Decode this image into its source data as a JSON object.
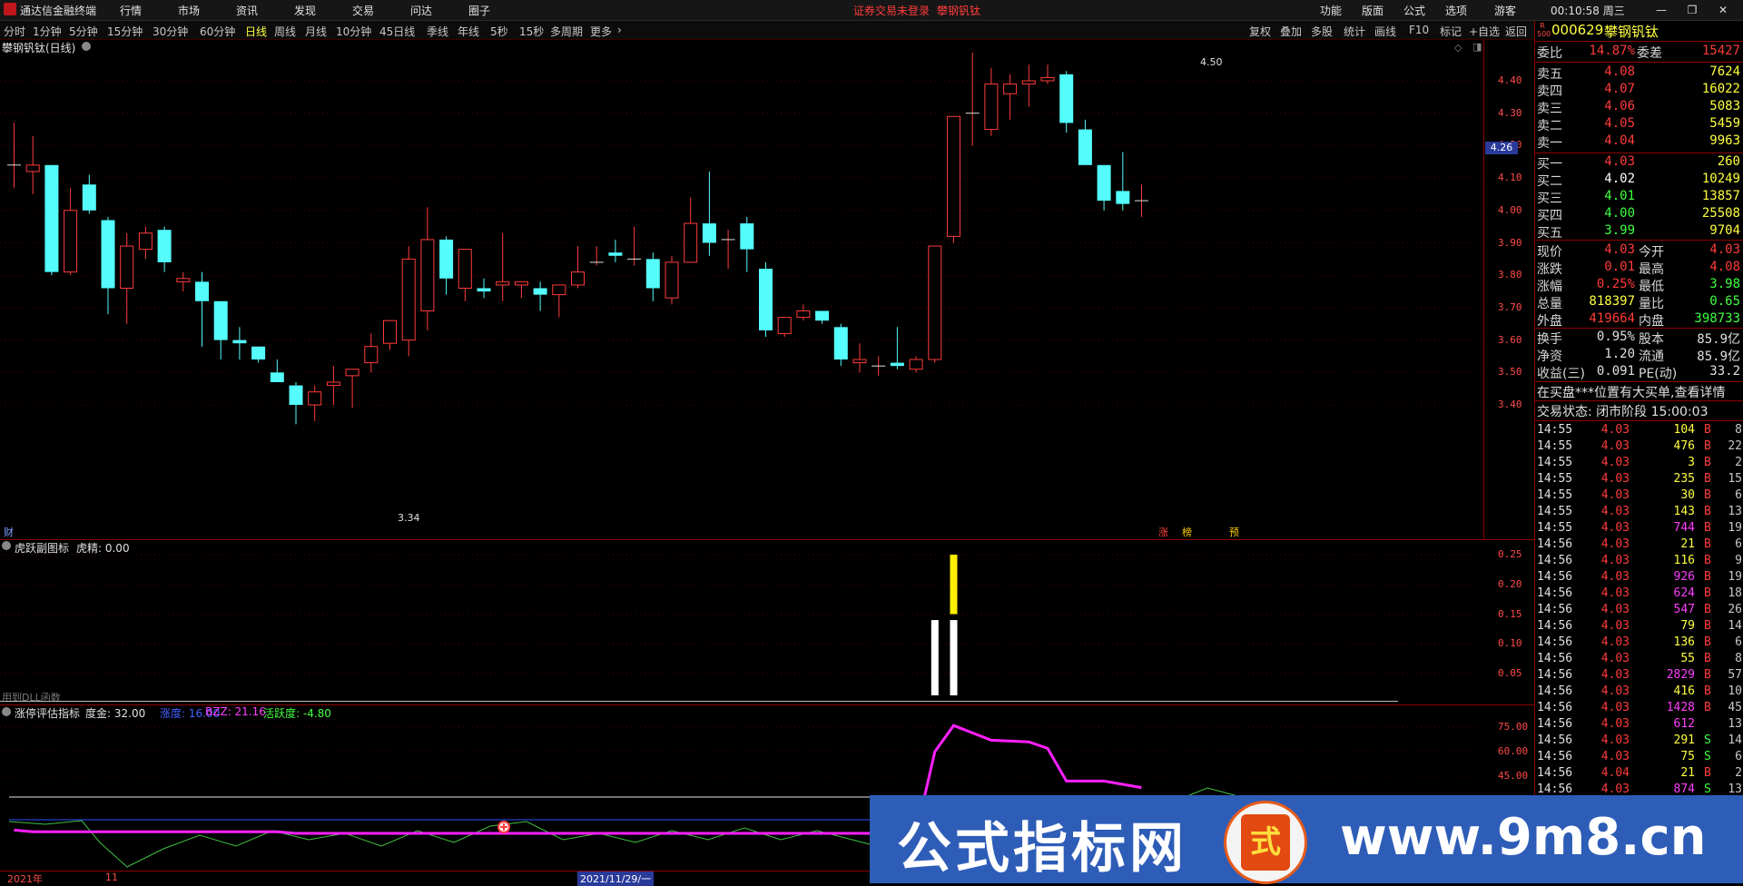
{
  "titlebar": {
    "app_name": "通达信金融终端",
    "menu": [
      "行情",
      "市场",
      "资讯",
      "发现",
      "交易",
      "问达",
      "圈子"
    ],
    "status_warning": "证券交易未登录",
    "stock_name": "攀钢钒钛",
    "right_menu": [
      "功能",
      "版面",
      "公式",
      "选项"
    ],
    "user": "游客",
    "clock": "00:10:58 周三",
    "win_min": "—",
    "win_restore": "❐",
    "win_close": "✕"
  },
  "periodbar": {
    "items": [
      "分时",
      "1分钟",
      "5分钟",
      "15分钟",
      "30分钟",
      "60分钟",
      "日线",
      "周线",
      "月线",
      "10分钟",
      "45日线",
      "季线",
      "年线",
      "5秒",
      "15秒",
      "多周期",
      "更多"
    ],
    "active": "日线",
    "right_buttons": [
      "复权",
      "叠加",
      "多股",
      "统计",
      "画线",
      "F10",
      "标记",
      "+自选",
      "返回"
    ]
  },
  "main_chart": {
    "title": "攀钢钒钛(日线)",
    "y_ticks": [
      "4.40",
      "4.30",
      "4.20",
      "4.10",
      "4.00",
      "3.90",
      "3.80",
      "3.70",
      "3.60",
      "3.50",
      "3.40"
    ],
    "current_price_tag": "4.26",
    "high_label": "4.50",
    "low_label": "3.34",
    "marker_left": "财",
    "signal_tags": [
      "涨",
      "榜",
      "预"
    ]
  },
  "chart_data": {
    "type": "candlestick",
    "price_ylim": [
      3.3,
      4.55
    ],
    "candles": [
      {
        "o": 4.14,
        "h": 4.27,
        "l": 4.07,
        "c": 4.14
      },
      {
        "o": 4.12,
        "h": 4.23,
        "l": 4.05,
        "c": 4.14
      },
      {
        "o": 4.14,
        "h": 4.14,
        "l": 3.8,
        "c": 3.81
      },
      {
        "o": 3.81,
        "h": 4.07,
        "l": 3.8,
        "c": 4.0
      },
      {
        "o": 4.08,
        "h": 4.11,
        "l": 3.99,
        "c": 4.0
      },
      {
        "o": 3.97,
        "h": 3.98,
        "l": 3.68,
        "c": 3.76
      },
      {
        "o": 3.76,
        "h": 3.93,
        "l": 3.65,
        "c": 3.89
      },
      {
        "o": 3.88,
        "h": 3.95,
        "l": 3.85,
        "c": 3.93
      },
      {
        "o": 3.94,
        "h": 3.95,
        "l": 3.81,
        "c": 3.84
      },
      {
        "o": 3.78,
        "h": 3.81,
        "l": 3.75,
        "c": 3.79
      },
      {
        "o": 3.78,
        "h": 3.81,
        "l": 3.58,
        "c": 3.72
      },
      {
        "o": 3.72,
        "h": 3.72,
        "l": 3.54,
        "c": 3.6
      },
      {
        "o": 3.6,
        "h": 3.64,
        "l": 3.54,
        "c": 3.59
      },
      {
        "o": 3.58,
        "h": 3.58,
        "l": 3.53,
        "c": 3.54
      },
      {
        "o": 3.5,
        "h": 3.54,
        "l": 3.47,
        "c": 3.47
      },
      {
        "o": 3.46,
        "h": 3.47,
        "l": 3.34,
        "c": 3.4
      },
      {
        "o": 3.4,
        "h": 3.46,
        "l": 3.35,
        "c": 3.44
      },
      {
        "o": 3.46,
        "h": 3.52,
        "l": 3.4,
        "c": 3.47
      },
      {
        "o": 3.49,
        "h": 3.51,
        "l": 3.39,
        "c": 3.51
      },
      {
        "o": 3.53,
        "h": 3.62,
        "l": 3.5,
        "c": 3.58
      },
      {
        "o": 3.59,
        "h": 3.66,
        "l": 3.57,
        "c": 3.66
      },
      {
        "o": 3.6,
        "h": 3.89,
        "l": 3.55,
        "c": 3.85
      },
      {
        "o": 3.69,
        "h": 4.01,
        "l": 3.63,
        "c": 3.91
      },
      {
        "o": 3.91,
        "h": 3.92,
        "l": 3.74,
        "c": 3.79
      },
      {
        "o": 3.76,
        "h": 3.88,
        "l": 3.72,
        "c": 3.88
      },
      {
        "o": 3.76,
        "h": 3.79,
        "l": 3.73,
        "c": 3.75
      },
      {
        "o": 3.77,
        "h": 3.93,
        "l": 3.72,
        "c": 3.78
      },
      {
        "o": 3.77,
        "h": 3.78,
        "l": 3.73,
        "c": 3.78
      },
      {
        "o": 3.76,
        "h": 3.78,
        "l": 3.69,
        "c": 3.74
      },
      {
        "o": 3.74,
        "h": 3.77,
        "l": 3.67,
        "c": 3.77
      },
      {
        "o": 3.77,
        "h": 3.89,
        "l": 3.76,
        "c": 3.81
      },
      {
        "o": 3.84,
        "h": 3.89,
        "l": 3.83,
        "c": 3.84
      },
      {
        "o": 3.87,
        "h": 3.91,
        "l": 3.84,
        "c": 3.86
      },
      {
        "o": 3.85,
        "h": 3.95,
        "l": 3.83,
        "c": 3.85
      },
      {
        "o": 3.85,
        "h": 3.87,
        "l": 3.72,
        "c": 3.76
      },
      {
        "o": 3.73,
        "h": 3.86,
        "l": 3.71,
        "c": 3.84
      },
      {
        "o": 3.84,
        "h": 4.04,
        "l": 3.84,
        "c": 3.96
      },
      {
        "o": 3.96,
        "h": 4.12,
        "l": 3.86,
        "c": 3.9
      },
      {
        "o": 3.91,
        "h": 3.94,
        "l": 3.82,
        "c": 3.91
      },
      {
        "o": 3.96,
        "h": 3.98,
        "l": 3.81,
        "c": 3.88
      },
      {
        "o": 3.82,
        "h": 3.84,
        "l": 3.61,
        "c": 3.63
      },
      {
        "o": 3.62,
        "h": 3.66,
        "l": 3.61,
        "c": 3.67
      },
      {
        "o": 3.67,
        "h": 3.71,
        "l": 3.66,
        "c": 3.69
      },
      {
        "o": 3.69,
        "h": 3.69,
        "l": 3.65,
        "c": 3.66
      },
      {
        "o": 3.64,
        "h": 3.65,
        "l": 3.52,
        "c": 3.54
      },
      {
        "o": 3.53,
        "h": 3.59,
        "l": 3.5,
        "c": 3.54
      },
      {
        "o": 3.52,
        "h": 3.55,
        "l": 3.49,
        "c": 3.52
      },
      {
        "o": 3.53,
        "h": 3.64,
        "l": 3.51,
        "c": 3.52
      },
      {
        "o": 3.51,
        "h": 3.55,
        "l": 3.5,
        "c": 3.54
      },
      {
        "o": 3.54,
        "h": 3.89,
        "l": 3.53,
        "c": 3.89
      },
      {
        "o": 3.92,
        "h": 4.29,
        "l": 3.9,
        "c": 4.29
      },
      {
        "o": 4.3,
        "h": 4.5,
        "l": 4.2,
        "c": 4.3
      },
      {
        "o": 4.25,
        "h": 4.44,
        "l": 4.23,
        "c": 4.39
      },
      {
        "o": 4.36,
        "h": 4.42,
        "l": 4.28,
        "c": 4.39
      },
      {
        "o": 4.39,
        "h": 4.45,
        "l": 4.32,
        "c": 4.4
      },
      {
        "o": 4.4,
        "h": 4.45,
        "l": 4.39,
        "c": 4.41
      },
      {
        "o": 4.42,
        "h": 4.43,
        "l": 4.24,
        "c": 4.27
      },
      {
        "o": 4.25,
        "h": 4.28,
        "l": 4.14,
        "c": 4.14
      },
      {
        "o": 4.14,
        "h": 4.14,
        "l": 4.0,
        "c": 4.03
      },
      {
        "o": 4.06,
        "h": 4.18,
        "l": 4.0,
        "c": 4.02
      },
      {
        "o": 4.03,
        "h": 4.08,
        "l": 3.98,
        "c": 4.03
      }
    ],
    "indicator1": {
      "bars": [
        {
          "index": 49,
          "value": 0.14,
          "color": "#ffffff"
        },
        {
          "index": 50,
          "value": 0.14,
          "color": "#ffffff"
        },
        {
          "index": 50,
          "value": 0.25,
          "base": 0.15,
          "color": "#ffee00"
        }
      ],
      "ylim": [
        0,
        0.28
      ]
    },
    "indicator2": {
      "magenta": [
        [
          0,
          12
        ],
        [
          1,
          11
        ],
        [
          14,
          11
        ],
        [
          15,
          10
        ],
        [
          48,
          10
        ],
        [
          49,
          60
        ],
        [
          50,
          76
        ],
        [
          52,
          67
        ],
        [
          54,
          66
        ],
        [
          55,
          62
        ],
        [
          56,
          42
        ],
        [
          58,
          42
        ],
        [
          59,
          40
        ],
        [
          60,
          38
        ]
      ],
      "ylim": [
        0,
        80
      ]
    }
  },
  "indicator1": {
    "name": "虎跃副图标",
    "value_label": "虎精: 0.00",
    "y_ticks": [
      "0.25",
      "0.20",
      "0.15",
      "0.10",
      "0.05"
    ],
    "footer": "用到DLL函数"
  },
  "indicator2": {
    "name": "涨停评估指标",
    "values": [
      {
        "label": "度金: 32.00",
        "color": "#e0e0e0"
      },
      {
        "label": "涨度: 16.00",
        "color": "#4060ff"
      },
      {
        "label": "BZZ: 21.16",
        "color": "#ff40ff"
      },
      {
        "label": "活跃度: -4.80",
        "color": "#40ff40"
      }
    ],
    "y_ticks": [
      "75.00",
      "60.00",
      "45.00"
    ]
  },
  "bottom_axis": {
    "labels": [
      "2021年",
      "11",
      "2021/11/29/一"
    ]
  },
  "quote": {
    "code": "000629",
    "name": "攀钢钒钛",
    "badge_r": "R",
    "badge_num": "500",
    "webi_label": "委比",
    "webi": "14.87%",
    "wecha_label": "委差",
    "wecha": "15427",
    "sells": [
      {
        "label": "卖五",
        "price": "4.08",
        "vol": "7624"
      },
      {
        "label": "卖四",
        "price": "4.07",
        "vol": "16022"
      },
      {
        "label": "卖三",
        "price": "4.06",
        "vol": "5083"
      },
      {
        "label": "卖二",
        "price": "4.05",
        "vol": "5459"
      },
      {
        "label": "卖一",
        "price": "4.04",
        "vol": "9963"
      }
    ],
    "buys": [
      {
        "label": "买一",
        "price": "4.03",
        "vol": "260",
        "color": "#ff3b3b"
      },
      {
        "label": "买二",
        "price": "4.02",
        "vol": "10249",
        "color": "#ffffff"
      },
      {
        "label": "买三",
        "price": "4.01",
        "vol": "13857",
        "color": "#40ff40"
      },
      {
        "label": "买四",
        "price": "4.00",
        "vol": "25508",
        "color": "#40ff40"
      },
      {
        "label": "买五",
        "price": "3.99",
        "vol": "9704",
        "color": "#40ff40"
      }
    ],
    "stats": [
      {
        "l1": "现价",
        "v1": "4.03",
        "c1": "#ff3b3b",
        "l2": "今开",
        "v2": "4.03",
        "c2": "#ff3b3b"
      },
      {
        "l1": "涨跌",
        "v1": "0.01",
        "c1": "#ff3b3b",
        "l2": "最高",
        "v2": "4.08",
        "c2": "#ff3b3b"
      },
      {
        "l1": "涨幅",
        "v1": "0.25%",
        "c1": "#ff3b3b",
        "l2": "最低",
        "v2": "3.98",
        "c2": "#40ff40"
      },
      {
        "l1": "总量",
        "v1": "818397",
        "c1": "#ffff40",
        "l2": "量比",
        "v2": "0.65",
        "c2": "#40ff40"
      },
      {
        "l1": "外盘",
        "v1": "419664",
        "c1": "#ff3b3b",
        "l2": "内盘",
        "v2": "398733",
        "c2": "#40ff40"
      }
    ],
    "stats2": [
      {
        "l1": "换手",
        "v1": "0.95%",
        "l2": "股本",
        "v2": "85.9亿"
      },
      {
        "l1": "净资",
        "v1": "1.20",
        "l2": "流通",
        "v2": "85.9亿"
      },
      {
        "l1": "收益(三)",
        "v1": "0.091",
        "l2": "PE(动)",
        "v2": "33.2"
      }
    ],
    "notice": "在买盘***位置有大买单,查看详情",
    "trade_state": "交易状态: 闭市阶段 15:00:03"
  },
  "ticks": [
    {
      "t": "14:55",
      "p": "4.03",
      "v": "104",
      "vc": "#ffff40",
      "bs": "B",
      "n": "8"
    },
    {
      "t": "14:55",
      "p": "4.03",
      "v": "476",
      "vc": "#ffff40",
      "bs": "B",
      "n": "22"
    },
    {
      "t": "14:55",
      "p": "4.03",
      "v": "3",
      "vc": "#ffff40",
      "bs": "B",
      "n": "2"
    },
    {
      "t": "14:55",
      "p": "4.03",
      "v": "235",
      "vc": "#ffff40",
      "bs": "B",
      "n": "15"
    },
    {
      "t": "14:55",
      "p": "4.03",
      "v": "30",
      "vc": "#ffff40",
      "bs": "B",
      "n": "6"
    },
    {
      "t": "14:55",
      "p": "4.03",
      "v": "143",
      "vc": "#ffff40",
      "bs": "B",
      "n": "13"
    },
    {
      "t": "14:55",
      "p": "4.03",
      "v": "744",
      "vc": "#ff40ff",
      "bs": "B",
      "n": "19"
    },
    {
      "t": "14:56",
      "p": "4.03",
      "v": "21",
      "vc": "#ffff40",
      "bs": "B",
      "n": "6"
    },
    {
      "t": "14:56",
      "p": "4.03",
      "v": "116",
      "vc": "#ffff40",
      "bs": "B",
      "n": "9"
    },
    {
      "t": "14:56",
      "p": "4.03",
      "v": "926",
      "vc": "#ff40ff",
      "bs": "B",
      "n": "19"
    },
    {
      "t": "14:56",
      "p": "4.03",
      "v": "624",
      "vc": "#ff40ff",
      "bs": "B",
      "n": "18"
    },
    {
      "t": "14:56",
      "p": "4.03",
      "v": "547",
      "vc": "#ff40ff",
      "bs": "B",
      "n": "26"
    },
    {
      "t": "14:56",
      "p": "4.03",
      "v": "79",
      "vc": "#ffff40",
      "bs": "B",
      "n": "14"
    },
    {
      "t": "14:56",
      "p": "4.03",
      "v": "136",
      "vc": "#ffff40",
      "bs": "B",
      "n": "6"
    },
    {
      "t": "14:56",
      "p": "4.03",
      "v": "55",
      "vc": "#ffff40",
      "bs": "B",
      "n": "8"
    },
    {
      "t": "14:56",
      "p": "4.03",
      "v": "2829",
      "vc": "#ff40ff",
      "bs": "B",
      "n": "57"
    },
    {
      "t": "14:56",
      "p": "4.03",
      "v": "416",
      "vc": "#ffff40",
      "bs": "B",
      "n": "10"
    },
    {
      "t": "14:56",
      "p": "4.03",
      "v": "1428",
      "vc": "#ff40ff",
      "bs": "B",
      "n": "45"
    },
    {
      "t": "14:56",
      "p": "4.03",
      "v": "612",
      "vc": "#ff40ff",
      "bs": "",
      "n": "13"
    },
    {
      "t": "14:56",
      "p": "4.03",
      "v": "291",
      "vc": "#ffff40",
      "bs": "S",
      "n": "14"
    },
    {
      "t": "14:56",
      "p": "4.03",
      "v": "75",
      "vc": "#ffff40",
      "bs": "S",
      "n": "6"
    },
    {
      "t": "14:56",
      "p": "4.04",
      "v": "21",
      "vc": "#ffff40",
      "bs": "B",
      "n": "2"
    },
    {
      "t": "14:56",
      "p": "4.03",
      "v": "874",
      "vc": "#ff40ff",
      "bs": "S",
      "n": "13"
    }
  ],
  "watermark": {
    "text_cn": "公式指标网",
    "url": "www.9m8.cn",
    "seal_glyph": "式"
  },
  "colors": {
    "up": "#ff3b3b",
    "down": "#54fcfc",
    "axis": "#8a0000",
    "active": "#ffff40"
  }
}
